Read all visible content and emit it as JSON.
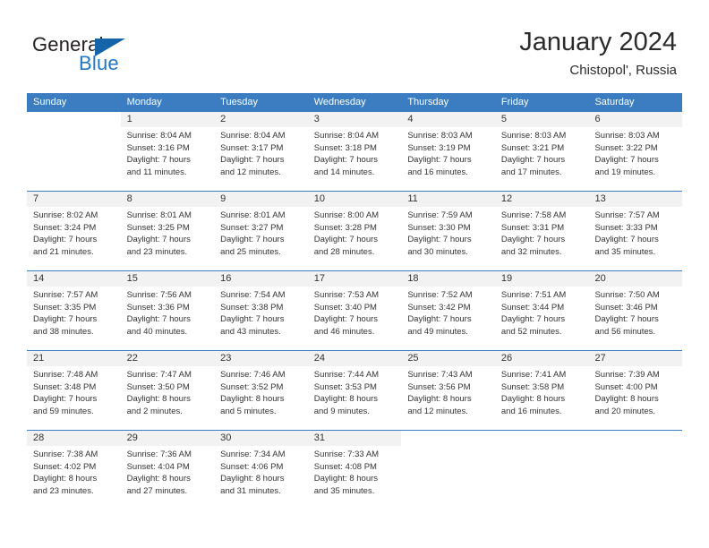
{
  "brand": {
    "name_part1": "General",
    "name_part2": "Blue"
  },
  "header": {
    "title": "January 2024",
    "subtitle": "Chistopol', Russia"
  },
  "colors": {
    "header_blue": "#3b7dc0",
    "logo_blue": "#1f77c4",
    "daynum_band": "#f2f2f2"
  },
  "calendar": {
    "weekdays": [
      "Sunday",
      "Monday",
      "Tuesday",
      "Wednesday",
      "Thursday",
      "Friday",
      "Saturday"
    ],
    "weeks": [
      [
        {
          "day": "",
          "sunrise": "",
          "sunset": "",
          "daylight1": "",
          "daylight2": ""
        },
        {
          "day": "1",
          "sunrise": "Sunrise: 8:04 AM",
          "sunset": "Sunset: 3:16 PM",
          "daylight1": "Daylight: 7 hours",
          "daylight2": "and 11 minutes."
        },
        {
          "day": "2",
          "sunrise": "Sunrise: 8:04 AM",
          "sunset": "Sunset: 3:17 PM",
          "daylight1": "Daylight: 7 hours",
          "daylight2": "and 12 minutes."
        },
        {
          "day": "3",
          "sunrise": "Sunrise: 8:04 AM",
          "sunset": "Sunset: 3:18 PM",
          "daylight1": "Daylight: 7 hours",
          "daylight2": "and 14 minutes."
        },
        {
          "day": "4",
          "sunrise": "Sunrise: 8:03 AM",
          "sunset": "Sunset: 3:19 PM",
          "daylight1": "Daylight: 7 hours",
          "daylight2": "and 16 minutes."
        },
        {
          "day": "5",
          "sunrise": "Sunrise: 8:03 AM",
          "sunset": "Sunset: 3:21 PM",
          "daylight1": "Daylight: 7 hours",
          "daylight2": "and 17 minutes."
        },
        {
          "day": "6",
          "sunrise": "Sunrise: 8:03 AM",
          "sunset": "Sunset: 3:22 PM",
          "daylight1": "Daylight: 7 hours",
          "daylight2": "and 19 minutes."
        }
      ],
      [
        {
          "day": "7",
          "sunrise": "Sunrise: 8:02 AM",
          "sunset": "Sunset: 3:24 PM",
          "daylight1": "Daylight: 7 hours",
          "daylight2": "and 21 minutes."
        },
        {
          "day": "8",
          "sunrise": "Sunrise: 8:01 AM",
          "sunset": "Sunset: 3:25 PM",
          "daylight1": "Daylight: 7 hours",
          "daylight2": "and 23 minutes."
        },
        {
          "day": "9",
          "sunrise": "Sunrise: 8:01 AM",
          "sunset": "Sunset: 3:27 PM",
          "daylight1": "Daylight: 7 hours",
          "daylight2": "and 25 minutes."
        },
        {
          "day": "10",
          "sunrise": "Sunrise: 8:00 AM",
          "sunset": "Sunset: 3:28 PM",
          "daylight1": "Daylight: 7 hours",
          "daylight2": "and 28 minutes."
        },
        {
          "day": "11",
          "sunrise": "Sunrise: 7:59 AM",
          "sunset": "Sunset: 3:30 PM",
          "daylight1": "Daylight: 7 hours",
          "daylight2": "and 30 minutes."
        },
        {
          "day": "12",
          "sunrise": "Sunrise: 7:58 AM",
          "sunset": "Sunset: 3:31 PM",
          "daylight1": "Daylight: 7 hours",
          "daylight2": "and 32 minutes."
        },
        {
          "day": "13",
          "sunrise": "Sunrise: 7:57 AM",
          "sunset": "Sunset: 3:33 PM",
          "daylight1": "Daylight: 7 hours",
          "daylight2": "and 35 minutes."
        }
      ],
      [
        {
          "day": "14",
          "sunrise": "Sunrise: 7:57 AM",
          "sunset": "Sunset: 3:35 PM",
          "daylight1": "Daylight: 7 hours",
          "daylight2": "and 38 minutes."
        },
        {
          "day": "15",
          "sunrise": "Sunrise: 7:56 AM",
          "sunset": "Sunset: 3:36 PM",
          "daylight1": "Daylight: 7 hours",
          "daylight2": "and 40 minutes."
        },
        {
          "day": "16",
          "sunrise": "Sunrise: 7:54 AM",
          "sunset": "Sunset: 3:38 PM",
          "daylight1": "Daylight: 7 hours",
          "daylight2": "and 43 minutes."
        },
        {
          "day": "17",
          "sunrise": "Sunrise: 7:53 AM",
          "sunset": "Sunset: 3:40 PM",
          "daylight1": "Daylight: 7 hours",
          "daylight2": "and 46 minutes."
        },
        {
          "day": "18",
          "sunrise": "Sunrise: 7:52 AM",
          "sunset": "Sunset: 3:42 PM",
          "daylight1": "Daylight: 7 hours",
          "daylight2": "and 49 minutes."
        },
        {
          "day": "19",
          "sunrise": "Sunrise: 7:51 AM",
          "sunset": "Sunset: 3:44 PM",
          "daylight1": "Daylight: 7 hours",
          "daylight2": "and 52 minutes."
        },
        {
          "day": "20",
          "sunrise": "Sunrise: 7:50 AM",
          "sunset": "Sunset: 3:46 PM",
          "daylight1": "Daylight: 7 hours",
          "daylight2": "and 56 minutes."
        }
      ],
      [
        {
          "day": "21",
          "sunrise": "Sunrise: 7:48 AM",
          "sunset": "Sunset: 3:48 PM",
          "daylight1": "Daylight: 7 hours",
          "daylight2": "and 59 minutes."
        },
        {
          "day": "22",
          "sunrise": "Sunrise: 7:47 AM",
          "sunset": "Sunset: 3:50 PM",
          "daylight1": "Daylight: 8 hours",
          "daylight2": "and 2 minutes."
        },
        {
          "day": "23",
          "sunrise": "Sunrise: 7:46 AM",
          "sunset": "Sunset: 3:52 PM",
          "daylight1": "Daylight: 8 hours",
          "daylight2": "and 5 minutes."
        },
        {
          "day": "24",
          "sunrise": "Sunrise: 7:44 AM",
          "sunset": "Sunset: 3:53 PM",
          "daylight1": "Daylight: 8 hours",
          "daylight2": "and 9 minutes."
        },
        {
          "day": "25",
          "sunrise": "Sunrise: 7:43 AM",
          "sunset": "Sunset: 3:56 PM",
          "daylight1": "Daylight: 8 hours",
          "daylight2": "and 12 minutes."
        },
        {
          "day": "26",
          "sunrise": "Sunrise: 7:41 AM",
          "sunset": "Sunset: 3:58 PM",
          "daylight1": "Daylight: 8 hours",
          "daylight2": "and 16 minutes."
        },
        {
          "day": "27",
          "sunrise": "Sunrise: 7:39 AM",
          "sunset": "Sunset: 4:00 PM",
          "daylight1": "Daylight: 8 hours",
          "daylight2": "and 20 minutes."
        }
      ],
      [
        {
          "day": "28",
          "sunrise": "Sunrise: 7:38 AM",
          "sunset": "Sunset: 4:02 PM",
          "daylight1": "Daylight: 8 hours",
          "daylight2": "and 23 minutes."
        },
        {
          "day": "29",
          "sunrise": "Sunrise: 7:36 AM",
          "sunset": "Sunset: 4:04 PM",
          "daylight1": "Daylight: 8 hours",
          "daylight2": "and 27 minutes."
        },
        {
          "day": "30",
          "sunrise": "Sunrise: 7:34 AM",
          "sunset": "Sunset: 4:06 PM",
          "daylight1": "Daylight: 8 hours",
          "daylight2": "and 31 minutes."
        },
        {
          "day": "31",
          "sunrise": "Sunrise: 7:33 AM",
          "sunset": "Sunset: 4:08 PM",
          "daylight1": "Daylight: 8 hours",
          "daylight2": "and 35 minutes."
        },
        {
          "day": "",
          "sunrise": "",
          "sunset": "",
          "daylight1": "",
          "daylight2": ""
        },
        {
          "day": "",
          "sunrise": "",
          "sunset": "",
          "daylight1": "",
          "daylight2": ""
        },
        {
          "day": "",
          "sunrise": "",
          "sunset": "",
          "daylight1": "",
          "daylight2": ""
        }
      ]
    ]
  }
}
